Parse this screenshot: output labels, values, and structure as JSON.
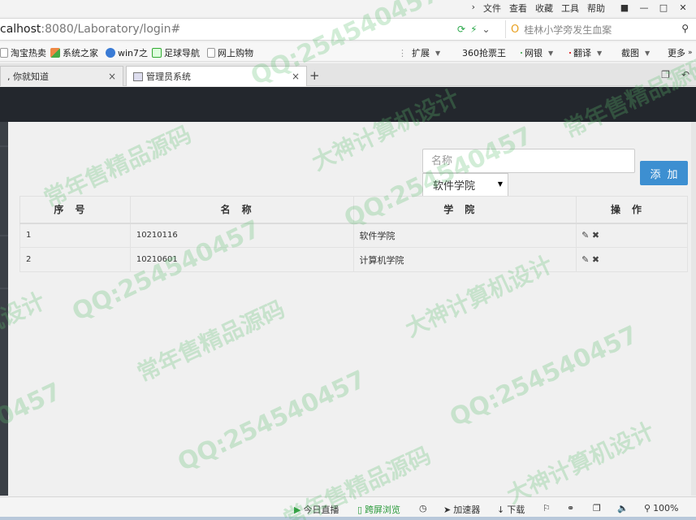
{
  "browser": {
    "menus": [
      "文件",
      "查看",
      "收藏",
      "工具",
      "帮助"
    ],
    "url_host": "calhost",
    "url_rest": ":8080/Laboratory/login#",
    "search_text": "桂林小学旁发生血案",
    "bookmarks": [
      "淘宝热卖",
      "系统之家",
      "win7之",
      "足球导航",
      "网上购物"
    ],
    "toolbar_right": [
      "扩展",
      "360抢票王",
      "网银",
      "翻译",
      "截图",
      "更多"
    ],
    "tabs": [
      {
        "label": ", 你就知道"
      },
      {
        "label": "管理员系统"
      }
    ]
  },
  "form": {
    "name_placeholder": "名称",
    "college_selected": "软件学院",
    "add_label": "添加"
  },
  "table": {
    "headers": [
      "序号",
      "名称",
      "学院",
      "操作"
    ],
    "rows": [
      {
        "index": "1",
        "name": "10210116",
        "college": "软件学院"
      },
      {
        "index": "2",
        "name": "10210601",
        "college": "计算机学院"
      }
    ]
  },
  "status": {
    "items": [
      "今日直播",
      "跨屏浏览",
      "加速器",
      "下载"
    ],
    "zoom": "100%"
  },
  "watermark": {
    "lines": [
      "QQ:254540457",
      "常年售精品源码",
      "大神计算机设计"
    ]
  },
  "colors": {
    "accent": "#3d8fd1",
    "header_dark": "#23272d",
    "watermark": "#5cc06e"
  }
}
